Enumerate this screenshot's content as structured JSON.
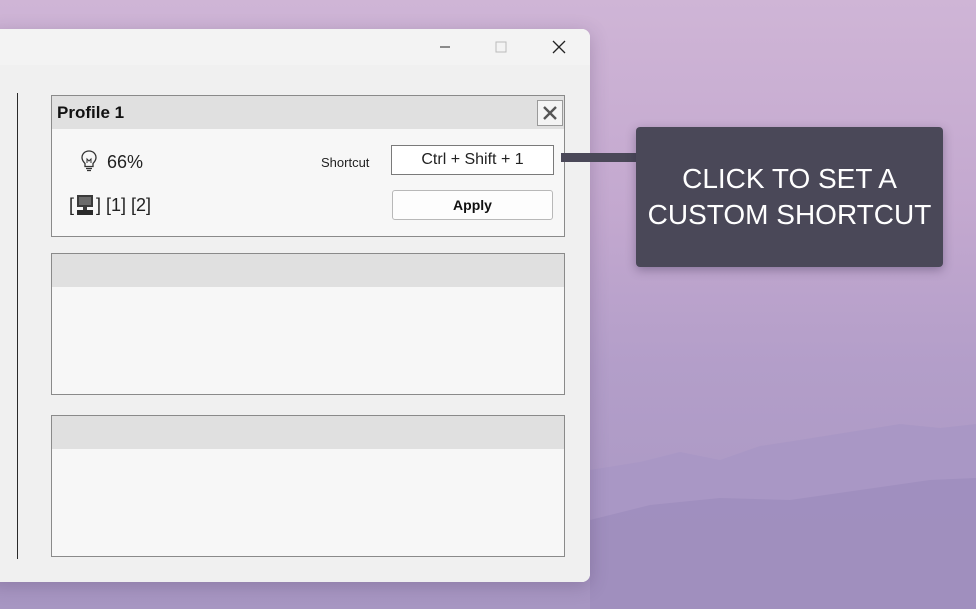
{
  "window": {
    "controls": {
      "minimize_icon": "minimize-icon",
      "maximize_icon": "maximize-icon",
      "close_icon": "close-icon"
    }
  },
  "profiles": [
    {
      "title": "Profile 1",
      "brightness": "66%",
      "shortcut_label": "Shortcut",
      "shortcut_value": "Ctrl + Shift + 1",
      "monitors_text": "] [1] [2]",
      "monitors_prefix": "[",
      "apply_label": "Apply"
    },
    {
      "title": ""
    },
    {
      "title": ""
    }
  ],
  "callout": {
    "text_line1": "CLICK TO SET A",
    "text_line2": "CUSTOM SHORTCUT"
  },
  "colors": {
    "callout_bg": "#4a4858",
    "panel_header": "#e0e0e0",
    "window_bg": "#f3f3f3"
  }
}
